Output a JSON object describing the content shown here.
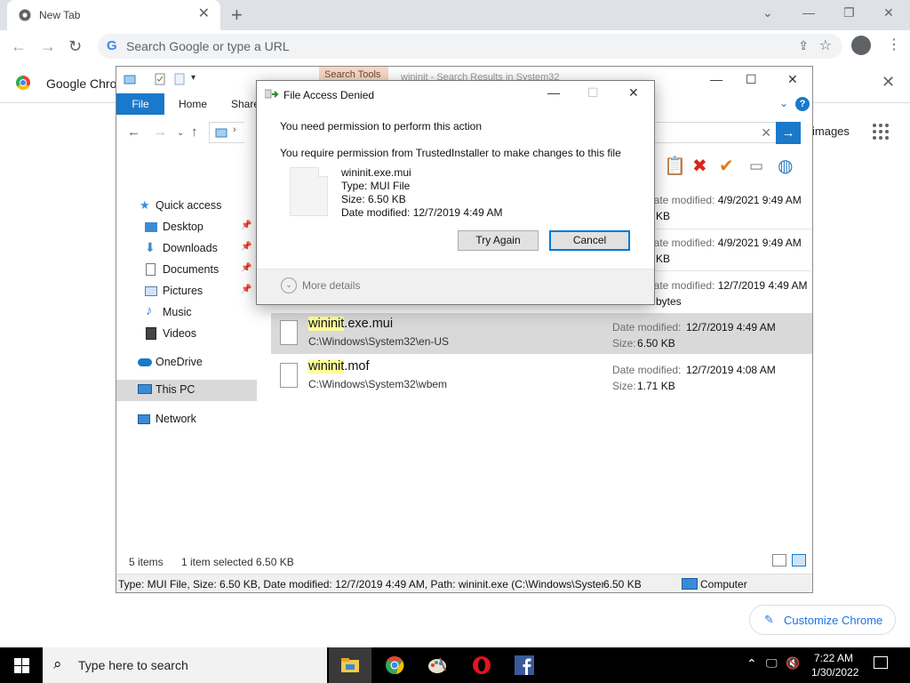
{
  "chrome": {
    "tab_title": "New Tab",
    "omnibox_placeholder": "Search Google or type a URL",
    "bookmark_label": "Google Chrom",
    "right_link": "images",
    "customize_label": "Customize Chrome"
  },
  "explorer": {
    "search_tools_label": "Search Tools",
    "window_title": "wininit - Search Results in System32",
    "ribbon_tabs": [
      "File",
      "Home",
      "Share"
    ],
    "nav_items": [
      {
        "label": "Quick access",
        "icon": "star-icon"
      },
      {
        "label": "Desktop",
        "icon": "desktop-icon",
        "pinned": true
      },
      {
        "label": "Downloads",
        "icon": "download-icon",
        "pinned": true
      },
      {
        "label": "Documents",
        "icon": "documents-icon",
        "pinned": true
      },
      {
        "label": "Pictures",
        "icon": "pictures-icon",
        "pinned": true
      },
      {
        "label": "Music",
        "icon": "music-icon"
      },
      {
        "label": "Videos",
        "icon": "videos-icon"
      },
      {
        "label": "OneDrive",
        "icon": "cloud-icon"
      },
      {
        "label": "This PC",
        "icon": "computer-icon",
        "selected": true
      },
      {
        "label": "Network",
        "icon": "network-icon"
      }
    ],
    "behind_rows": [
      {
        "dm_key": "Date modified:",
        "date": "4/9/2021 9:49 AM",
        "size": "KB"
      },
      {
        "dm_key": "Date modified:",
        "date": "4/9/2021 9:49 AM",
        "size": "KB"
      },
      {
        "dm_key": "Date modified:",
        "date": "12/7/2019 4:49 AM",
        "size": "bytes"
      }
    ],
    "files": [
      {
        "name_hl": "wininit",
        "name_rest": ".exe.mui",
        "path": "C:\\Windows\\System32\\en-US",
        "date_key": "Date modified:",
        "date": "12/7/2019 4:49 AM",
        "size_key": "Size:",
        "size": "6.50 KB",
        "selected": true
      },
      {
        "name_hl": "wininit",
        "name_rest": ".mof",
        "path": "C:\\Windows\\System32\\wbem",
        "date_key": "Date modified:",
        "date": "12/7/2019 4:08 AM",
        "size_key": "Size:",
        "size": "1.71 KB",
        "selected": false
      }
    ],
    "status_items": "5 items",
    "status_selected": "1 item selected  6.50 KB",
    "details_text": "Type: MUI File, Size: 6.50 KB, Date modified: 12/7/2019 4:49 AM, Path: wininit.exe (C:\\Windows\\System32\\en-US)",
    "details_size": "6.50 KB",
    "details_location": "Computer"
  },
  "dialog": {
    "title": "File Access Denied",
    "line1": "You need permission to perform this action",
    "line2": "You require permission from TrustedInstaller to make changes to this file",
    "file_name": "wininit.exe.mui",
    "file_type": "Type: MUI File",
    "file_size": "Size: 6.50 KB",
    "file_date": "Date modified: 12/7/2019 4:49 AM",
    "try_again": "Try Again",
    "cancel": "Cancel",
    "more_details": "More details"
  },
  "taskbar": {
    "search_placeholder": "Type here to search",
    "time": "7:22 AM",
    "date": "1/30/2022",
    "apps": [
      "file-explorer",
      "chrome",
      "paint",
      "opera",
      "facebook"
    ]
  },
  "colors": {
    "explorer_accent": "#1979ca",
    "highlight": "#ffff99",
    "chrome_accent": "#1a73e8"
  }
}
